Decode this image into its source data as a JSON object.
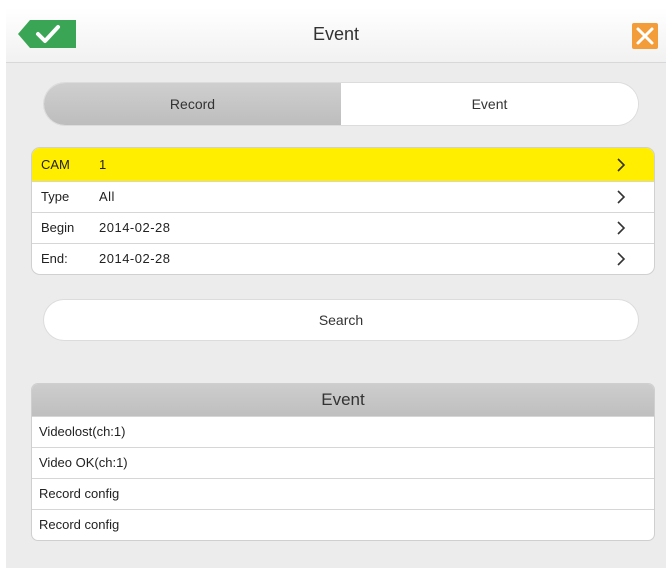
{
  "header": {
    "title": "Event",
    "ok_icon": "check-icon",
    "close_icon": "close-icon",
    "ok_color": "#3aa655",
    "close_color": "#f39c3a"
  },
  "tabs": [
    {
      "label": "Record",
      "active": false
    },
    {
      "label": "Event",
      "active": true
    }
  ],
  "filters": [
    {
      "label": "CAM",
      "value": "1",
      "selected": true
    },
    {
      "label": "Type",
      "value": "All",
      "selected": false
    },
    {
      "label": "Begin",
      "value": "2014-02-28",
      "selected": false
    },
    {
      "label": "End:",
      "value": "2014-02-28",
      "selected": false
    }
  ],
  "search": {
    "label": "Search"
  },
  "events": {
    "header": "Event",
    "items": [
      "Videolost(ch:1)",
      "Video OK(ch:1)",
      "Record config",
      "Record config"
    ]
  },
  "colors": {
    "highlight": "#ffee00"
  }
}
